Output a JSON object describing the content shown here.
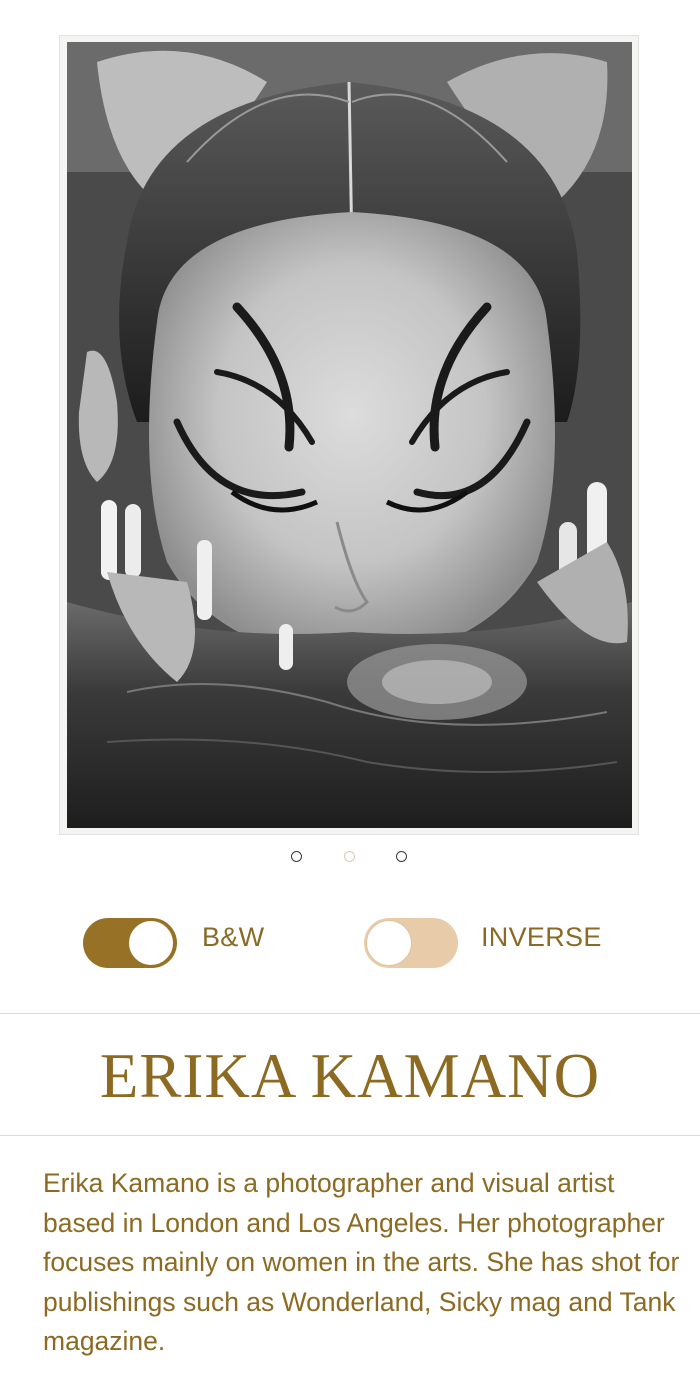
{
  "gallery": {
    "image_alt": "Black and white portrait of a woman with winged graphic eyeliner, face half submerged in water, long decorated nails",
    "dots": [
      {
        "state": "active"
      },
      {
        "state": "inactive"
      },
      {
        "state": "active"
      }
    ]
  },
  "filters": {
    "bw": {
      "label": "B&W",
      "on": true
    },
    "inverse": {
      "label": "INVERSE",
      "on": false
    }
  },
  "artist": {
    "name": "ERIKA KAMANO",
    "bio": "Erika Kamano is a photographer and visual artist based in London and Los Angeles. Her photographer focuses mainly on women in the arts. She has shot for publishings such as Wonderland, Sicky mag and Tank magazine."
  },
  "colors": {
    "accent": "#977125",
    "accent_light": "#e8ccaa",
    "text": "#8d6a22",
    "divider": "#e4d8bf"
  }
}
